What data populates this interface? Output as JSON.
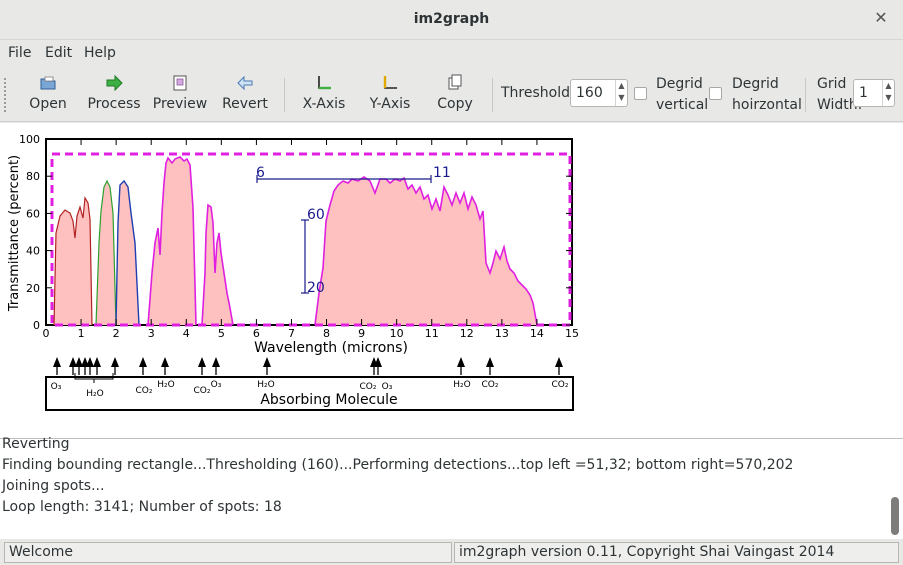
{
  "window": {
    "title": "im2graph"
  },
  "menu": {
    "file": "File",
    "edit": "Edit",
    "help": "Help"
  },
  "toolbar": {
    "open": "Open",
    "process": "Process",
    "preview": "Preview",
    "revert": "Revert",
    "x_axis": "X-Axis",
    "y_axis": "Y-Axis",
    "copy": "Copy",
    "threshold_label": "Threshold:",
    "threshold_value": "160",
    "degrid_vertical_1": "Degrid",
    "degrid_vertical_2": "vertical",
    "degrid_horizontal_1": "Degrid",
    "degrid_horizontal_2": "hoirzontal",
    "grid_width_1": "Grid",
    "grid_width_2": "Width:",
    "grid_width_value": "1"
  },
  "image": {
    "y_axis_label": "Transmittance (percent)",
    "x_axis_label": "Wavelength (microns)",
    "y_ticks": [
      "100",
      "80",
      "60",
      "40",
      "20",
      "0"
    ],
    "x_ticks": [
      "0",
      "1",
      "2",
      "3",
      "4",
      "5",
      "6",
      "7",
      "8",
      "9",
      "10",
      "11",
      "12",
      "13",
      "14",
      "15"
    ],
    "calib_x_start": "6",
    "calib_x_end": "11",
    "calib_y_top": "60",
    "calib_y_bottom": "20",
    "molecule_box_label": "Absorbing Molecule",
    "molecule_labels": [
      "O₃",
      "H₂O",
      "CO₂",
      "H₂O",
      "CO₂",
      "O₃",
      "H₂O",
      "CO₂",
      "O₃",
      "H₂O",
      "CO₂",
      "CO₂"
    ]
  },
  "log": {
    "lines": [
      "Reverting",
      "Finding bounding rectangle...Thresholding (160)...Performing detections...top left =51,32; bottom right=570,202",
      "Joining spots...",
      "Loop length: 3141; Number of spots: 18"
    ]
  },
  "status": {
    "left": "Welcome",
    "right": "im2graph version 0.11, Copyright Shai Vaingast 2014"
  },
  "colors": {
    "selection": "#e020e0",
    "fill": "#ffc0c0",
    "calib": "#1a1a8c"
  }
}
